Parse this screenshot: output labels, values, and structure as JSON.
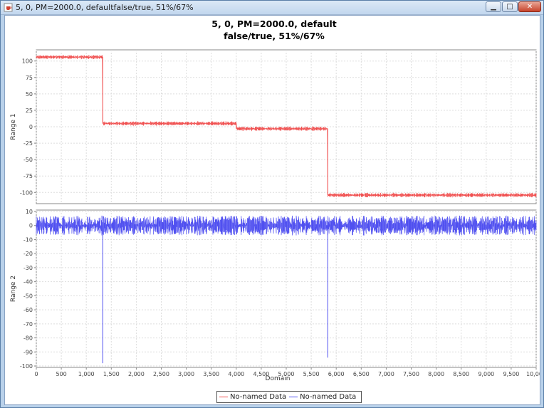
{
  "window": {
    "title": "5, 0, PM=2000.0, defaultfalse/true, 51%/67%",
    "minimize_glyph": "▁",
    "maximize_glyph": "□",
    "close_glyph": "✕"
  },
  "chart_data": {
    "type": "line",
    "title_line1": "5, 0, PM=2000.0, default",
    "title_line2": "false/true, 51%/67%",
    "xlabel": "Domain",
    "xlim": [
      0,
      10000
    ],
    "x_ticks": [
      0,
      500,
      1000,
      1500,
      2000,
      2500,
      3000,
      3500,
      4000,
      4500,
      5000,
      5500,
      6000,
      6500,
      7000,
      7500,
      8000,
      8500,
      9000,
      9500,
      10000
    ],
    "x_tick_labels": [
      "0",
      "500",
      "1,000",
      "1,500",
      "2,000",
      "2,500",
      "3,000",
      "3,500",
      "4,000",
      "4,500",
      "5,000",
      "5,500",
      "6,000",
      "6,500",
      "7,000",
      "7,500",
      "8,000",
      "8,500",
      "9,000",
      "9,500",
      "10,000"
    ],
    "grid": true,
    "legend_position": "bottom",
    "subplots": [
      {
        "ylabel": "Range 1",
        "ylim": [
          -117,
          117
        ],
        "y_ticks": [
          100,
          75,
          50,
          25,
          0,
          -25,
          -50,
          -75,
          -100
        ],
        "series": [
          {
            "name": "No-named Data",
            "color": "#f05050",
            "noise": 3,
            "segments": [
              {
                "x0": 0,
                "x1": 1330,
                "y": 106
              },
              {
                "x0": 1330,
                "x1": 4000,
                "y": 5
              },
              {
                "x0": 4000,
                "x1": 5830,
                "y": -3
              },
              {
                "x0": 5830,
                "x1": 10000,
                "y": -104
              }
            ]
          }
        ]
      },
      {
        "ylabel": "Range 2",
        "ylim": [
          -101,
          11
        ],
        "y_ticks": [
          10,
          0,
          -10,
          -20,
          -30,
          -40,
          -50,
          -60,
          -70,
          -80,
          -90,
          -100
        ],
        "series": [
          {
            "name": "No-named Data",
            "color": "#5050f0",
            "baseline": 0,
            "noise": 7,
            "spikes": [
              {
                "x": 1330,
                "y": -98
              },
              {
                "x": 5830,
                "y": -94
              }
            ]
          }
        ]
      }
    ]
  }
}
